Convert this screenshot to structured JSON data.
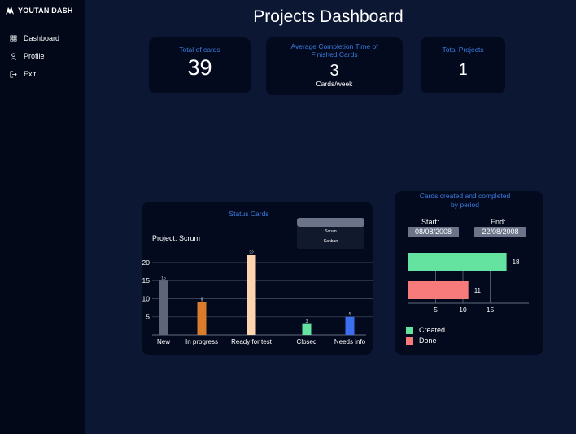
{
  "sidebar": {
    "brand": "YOUTAN DASH",
    "items": [
      {
        "label": "Dashboard",
        "icon": "dashboard-icon"
      },
      {
        "label": "Profile",
        "icon": "user-icon"
      },
      {
        "label": "Exit",
        "icon": "logout-icon"
      }
    ]
  },
  "page": {
    "title": "Projects Dashboard"
  },
  "kpis": {
    "total_cards": {
      "label": "Total of cards",
      "value": "39"
    },
    "avg_completion": {
      "label": "Average Completion Time of Finished Cards",
      "value": "3",
      "unit": "Cards/week"
    },
    "total_projects": {
      "label": "Total Projects",
      "value": "1"
    }
  },
  "status_panel": {
    "title": "Status Cards",
    "project_label": "Project: Scrum",
    "dropdown_options": [
      "Scrum",
      "Kanban"
    ]
  },
  "period_panel": {
    "title": "Cards created and completed by period",
    "start_label": "Start:",
    "start_value": "08/08/2008",
    "end_label": "End:",
    "end_value": "22/08/2008"
  },
  "colors": {
    "accent": "#3d7be0",
    "created": "#63e2a0",
    "done": "#f87b7b"
  },
  "chart_data": [
    {
      "type": "bar",
      "title": "Status Cards",
      "categories": [
        "New",
        "In progress",
        "Ready for test",
        "Closed",
        "Needs info"
      ],
      "values": [
        15,
        9,
        22,
        3,
        5
      ],
      "colors": [
        "#5d6577",
        "#d97c2c",
        "#fdd3b0",
        "#63e2a0",
        "#3b6ff0"
      ],
      "yticks": [
        5,
        10,
        15,
        20
      ],
      "ylim": [
        0,
        22
      ],
      "grid": true
    },
    {
      "type": "bar",
      "orientation": "horizontal",
      "title": "Cards created and completed by period",
      "categories": [
        "Created",
        "Done"
      ],
      "values": [
        18,
        11
      ],
      "colors": [
        "#63e2a0",
        "#f87b7b"
      ],
      "xticks": [
        5,
        10,
        15
      ],
      "xlim": [
        0,
        20
      ],
      "legend": "bottom-left"
    }
  ]
}
